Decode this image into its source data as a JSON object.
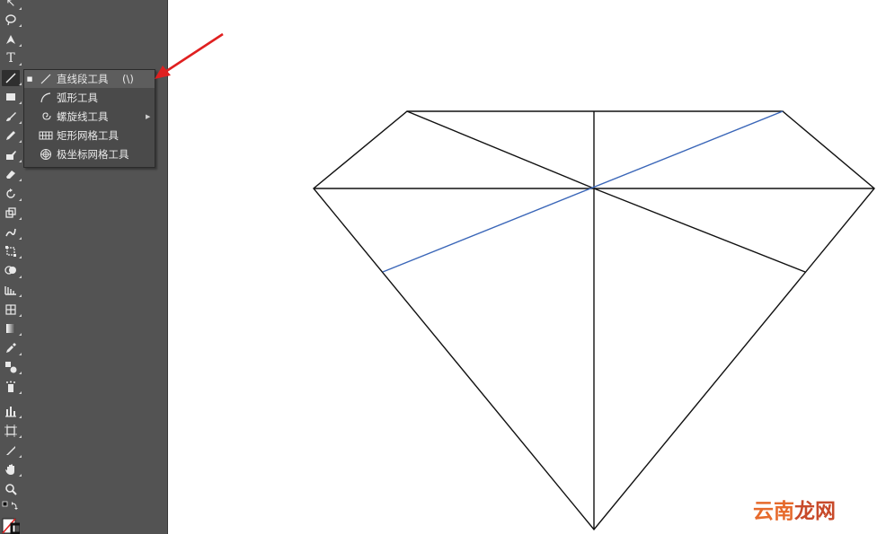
{
  "flyout": {
    "items": [
      {
        "label": "直线段工具",
        "shortcut": "(\\)",
        "icon": "line-segment-icon",
        "selected": true,
        "check": "■"
      },
      {
        "label": "弧形工具",
        "shortcut": "",
        "icon": "arc-icon",
        "selected": false,
        "check": ""
      },
      {
        "label": "螺旋线工具",
        "shortcut": "",
        "icon": "spiral-icon",
        "selected": false,
        "check": "",
        "submenu": true
      },
      {
        "label": "矩形网格工具",
        "shortcut": "",
        "icon": "rectangular-grid-icon",
        "selected": false,
        "check": ""
      },
      {
        "label": "极坐标网格工具",
        "shortcut": "",
        "icon": "polar-grid-icon",
        "selected": false,
        "check": ""
      }
    ]
  },
  "toolbar": {
    "tools": [
      "selection-icon",
      "lasso-icon",
      "pen-icon",
      "type-icon",
      "line-segment-icon",
      "rectangle-icon",
      "paintbrush-icon",
      "pencil-icon",
      "blob-brush-icon",
      "eraser-icon",
      "rotate-icon",
      "scale-icon",
      "warp-icon",
      "free-transform-icon",
      "shape-builder-icon",
      "perspective-grid-icon",
      "mesh-icon",
      "gradient-icon",
      "eyedropper-icon",
      "blend-icon",
      "symbol-sprayer-icon",
      "column-graph-icon",
      "artboard-icon",
      "slice-icon",
      "hand-icon",
      "zoom-icon",
      "swap-colors-icon",
      "fill-stroke-icon"
    ],
    "type_label": "T"
  },
  "colors": {
    "toolbar_bg": "#535353",
    "flyout_bg": "#4a4a4a",
    "highlight_line": "#3a66b8",
    "arrow": "#e02020",
    "stroke": "#111111"
  },
  "watermark": {
    "text1": "云南",
    "text2": "龙网"
  }
}
